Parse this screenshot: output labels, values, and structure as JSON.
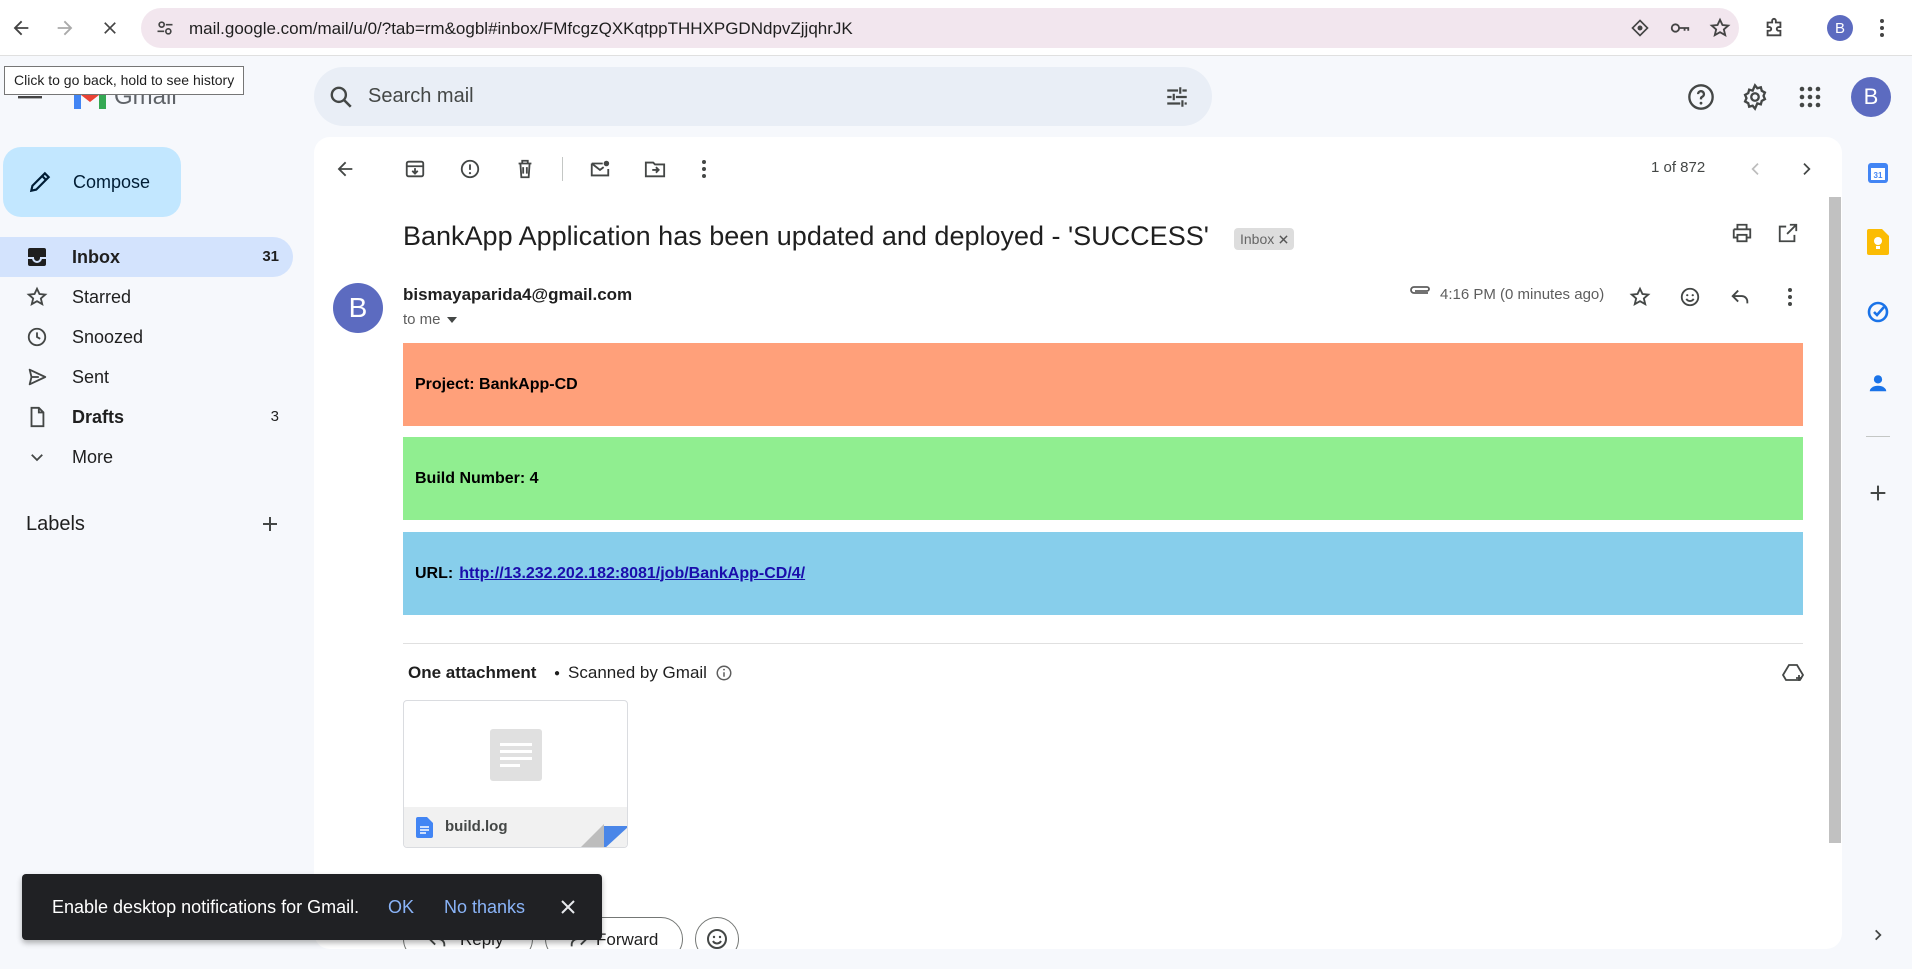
{
  "browser": {
    "url": "mail.google.com/mail/u/0/?tab=rm&ogbl#inbox/FMfcgzQXKqtppTHHXPGDNdpvZjjqhrJK",
    "tooltip": "Click to go back, hold to see history",
    "profile_initial": "B"
  },
  "header": {
    "app_name": "Gmail",
    "search_placeholder": "Search mail",
    "account_initial": "B"
  },
  "sidebar": {
    "compose_label": "Compose",
    "items": [
      {
        "label": "Inbox",
        "count": "31",
        "icon": "inbox-icon",
        "active": true
      },
      {
        "label": "Starred",
        "count": "",
        "icon": "star-icon"
      },
      {
        "label": "Snoozed",
        "count": "",
        "icon": "clock-icon"
      },
      {
        "label": "Sent",
        "count": "",
        "icon": "send-icon"
      },
      {
        "label": "Drafts",
        "count": "3",
        "icon": "draft-icon"
      },
      {
        "label": "More",
        "count": "",
        "icon": "chevron-down-icon"
      }
    ],
    "labels_title": "Labels"
  },
  "toolbar": {
    "pager": "1 of 872"
  },
  "email": {
    "subject": "BankApp Application has been updated and deployed - 'SUCCESS'",
    "label_chip": "Inbox",
    "sender": "bismayaparida4@gmail.com",
    "sender_initial": "B",
    "to": "to me",
    "time": "4:16 PM (0 minutes ago)",
    "body": {
      "project_label": "Project: BankApp-CD",
      "build_label": "Build Number: 4",
      "url_label": "URL:",
      "url_link": "http://13.232.202.182:8081/job/BankApp-CD/4/"
    },
    "attachments_title": "One attachment",
    "scanned": "Scanned by Gmail",
    "attachment_name": "build.log",
    "reply_label": "Reply",
    "forward_label": "Forward"
  },
  "snackbar": {
    "text": "Enable desktop notifications for Gmail.",
    "ok": "OK",
    "no_thanks": "No thanks"
  },
  "colors": {
    "project_band": "#ffa07a",
    "build_band": "#90ee90",
    "url_band": "#87ceeb",
    "compose_bg": "#c2e7ff",
    "active_nav": "#d3e3fd",
    "avatar": "#5c6bc0"
  }
}
